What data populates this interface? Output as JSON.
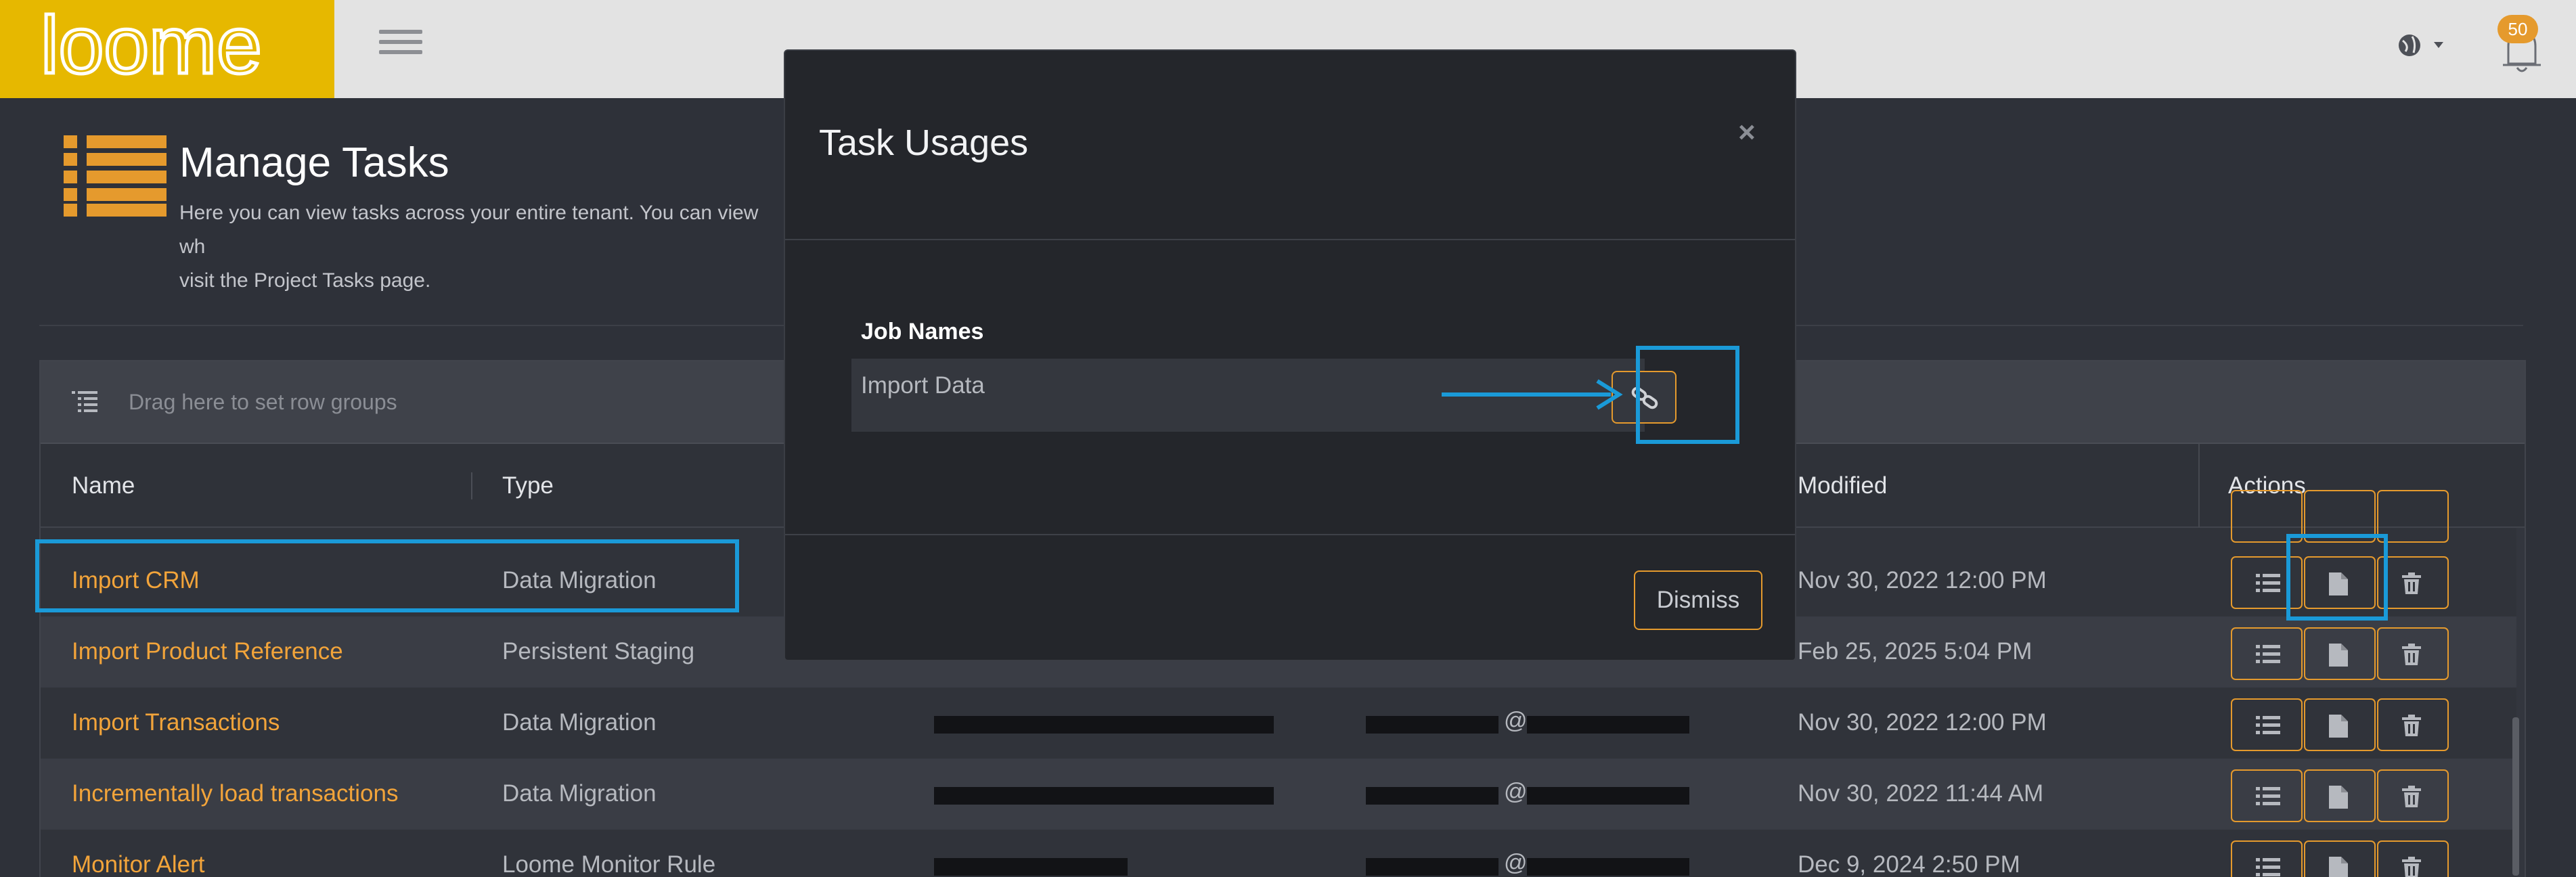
{
  "app": {
    "logo_text": "loome",
    "notification_count": "50"
  },
  "header": {
    "title": "Manage Tasks",
    "description_line1": "Here you can view tasks across your entire tenant. You can view wh",
    "description_line2": "visit the Project Tasks page."
  },
  "grid": {
    "group_placeholder": "Drag here to set row groups",
    "columns": {
      "name": "Name",
      "type": "Type",
      "modified": "Modified",
      "actions": "Actions"
    },
    "rows": [
      {
        "name": "Import CRM",
        "type": "Data Migration",
        "modified": "Nov 30, 2022 12:00 PM"
      },
      {
        "name": "Import Product Reference",
        "type": "Persistent Staging",
        "modified": "Feb 25, 2025 5:04 PM"
      },
      {
        "name": "Import Transactions",
        "type": "Data Migration",
        "modified": "Nov 30, 2022 12:00 PM"
      },
      {
        "name": "Incrementally load transactions",
        "type": "Data Migration",
        "modified": "Nov 30, 2022 11:44 AM"
      },
      {
        "name": "Monitor Alert",
        "type": "Loome Monitor Rule",
        "modified": "Dec 9, 2024 2:50 PM"
      }
    ],
    "owner_at": "@"
  },
  "modal": {
    "title": "Task Usages",
    "close": "×",
    "job_names_header": "Job Names",
    "jobs": [
      {
        "name": "Import Data"
      }
    ],
    "dismiss_label": "Dismiss"
  },
  "colors": {
    "accent": "#e59a2d",
    "brand": "#e6b800",
    "highlight": "#1a9ad8"
  }
}
